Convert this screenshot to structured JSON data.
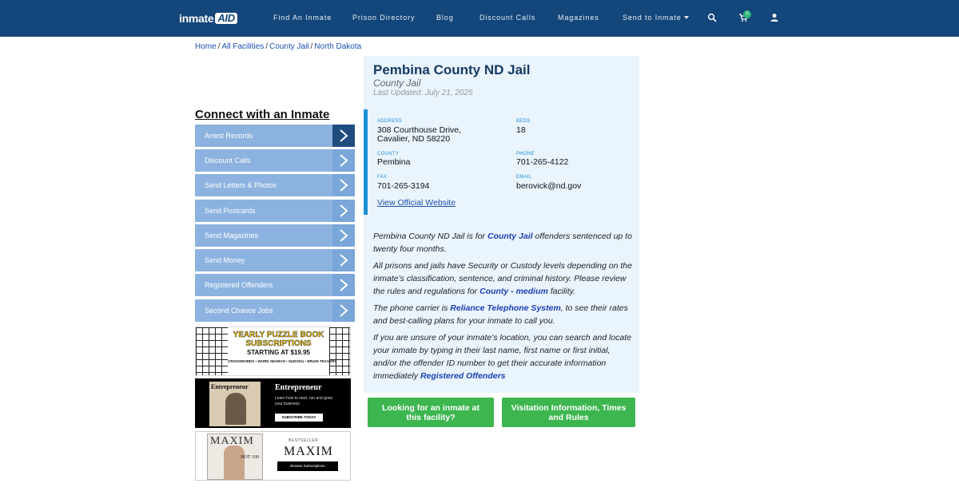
{
  "brand": {
    "logo_text": "inmate",
    "logo_suffix": "AID"
  },
  "nav": {
    "items": [
      {
        "label": "Find An Inmate"
      },
      {
        "label": "Prison Directory"
      },
      {
        "label": "Blog"
      },
      {
        "label": "Discount Calls"
      },
      {
        "label": "Magazines"
      },
      {
        "label": "Send to Inmate"
      }
    ],
    "cart_count": "0",
    "icons": [
      "search-icon",
      "cart-icon",
      "user-icon"
    ]
  },
  "breadcrumb": [
    "Home",
    "All Facilities",
    "County Jail",
    "North Dakota"
  ],
  "sidebar": {
    "title": "Connect with an Inmate",
    "items": [
      {
        "label": "Arrest Records"
      },
      {
        "label": "Discount Calls"
      },
      {
        "label": "Send Letters & Photos"
      },
      {
        "label": "Send Postcards"
      },
      {
        "label": "Send Magazines"
      },
      {
        "label": "Send Money"
      },
      {
        "label": "Registered Offenders"
      },
      {
        "label": "Second Chance Jobs"
      }
    ],
    "ads": {
      "puzzle": {
        "headline": "YEARLY PUZZLE BOOK SUBSCRIPTIONS",
        "price": "STARTING AT $19.95",
        "tagline": "CROSSWORDS • WORD SEARCH • SUDOKU • BRAIN TEASERS"
      },
      "entrepreneur": {
        "masthead": "Entrepreneur",
        "tagline": "Learn how to start, run and grow your business",
        "cta": "SUBSCRIBE TODAY"
      },
      "maxim": {
        "masthead": "MAXIM",
        "cover_text": "HOT 100",
        "badge": "BESTSELLER",
        "cta": "Browse Subscriptions"
      }
    }
  },
  "facility": {
    "name": "Pembina County ND Jail",
    "type": "County Jail",
    "updated": "Last Updated: July 21, 2025",
    "address_label": "ADDRESS",
    "address_line1": "308 Courthouse Drive,",
    "address_line2": "Cavalier, ND 58220",
    "beds_label": "BEDS",
    "beds": "18",
    "county_label": "COUNTY",
    "county": "Pembina",
    "phone_label": "PHONE",
    "phone": "701-265-4122",
    "fax_label": "FAX",
    "fax": "701-265-3194",
    "email_label": "EMAIL",
    "email": "berovick@nd.gov",
    "website_link": "View Official Website"
  },
  "description": {
    "p1_a": "Pembina County ND Jail is for ",
    "p1_link": "County Jail",
    "p1_b": " offenders sentenced up to twenty four months.",
    "p2_a": "All prisons and jails have Security or Custody levels depending on the inmate’s classification, sentence, and criminal history. Please review the rules and regulations for ",
    "p2_link": "County - medium",
    "p2_b": " facility.",
    "p3_a": "The phone carrier is ",
    "p3_link": "Reliance Telephone System",
    "p3_b": ", to see their rates and best-calling plans for your inmate to call you.",
    "p4_a": "If you are unsure of your inmate's location, you can search and locate your inmate by typing in their last name, first name or first initial, and/or the offender ID number to get their accurate information immediately ",
    "p4_link": "Registered Offenders"
  },
  "actions": {
    "find_inmate": "Looking for an inmate at this facility?",
    "visitation": "Visitation Information, Times and Rules"
  },
  "colors": {
    "nav_bg": "#13467a",
    "accent": "#1e8ed6",
    "button_green": "#3db650",
    "sidebar_btn": "#8cb3df",
    "card_bg": "#eaf4fc"
  }
}
